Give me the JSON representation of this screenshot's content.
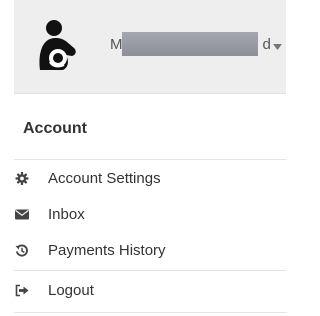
{
  "user": {
    "name_visible_start": "M",
    "name_visible_end": "d",
    "avatar_icon": "breastfeeding-icon",
    "dropdown_icon": "caret-down-icon"
  },
  "menu": {
    "section_title": "Account",
    "items": [
      {
        "label": "Account Settings",
        "icon": "gear-icon"
      },
      {
        "label": "Inbox",
        "icon": "envelope-icon"
      },
      {
        "label": "Payments History",
        "icon": "history-icon"
      },
      {
        "label": "Logout",
        "icon": "logout-icon"
      }
    ]
  },
  "colors": {
    "header_bg": "#eeeeee",
    "text": "#333333",
    "divider": "#e4e4e4"
  }
}
